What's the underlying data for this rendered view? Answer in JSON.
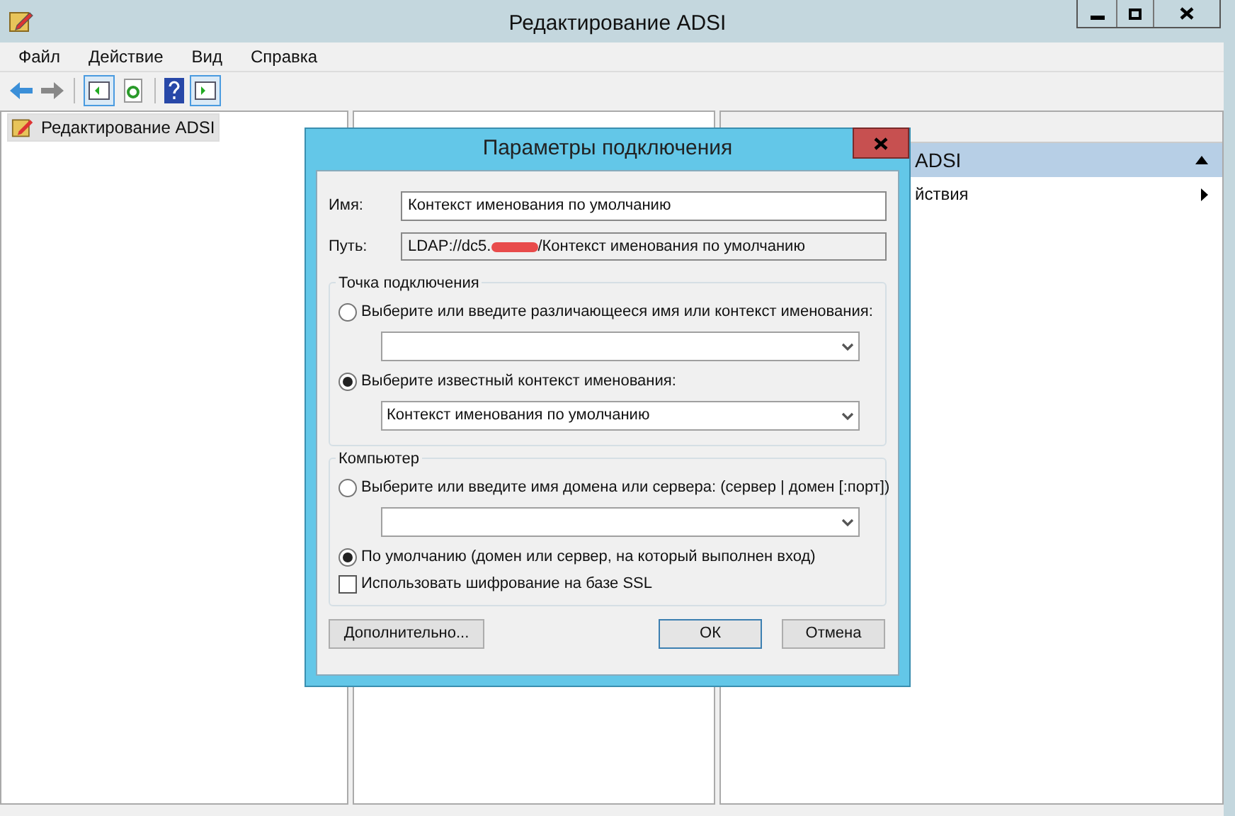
{
  "window": {
    "title": "Редактирование ADSI"
  },
  "menu": [
    "Файл",
    "Действие",
    "Вид",
    "Справка"
  ],
  "tree": {
    "items": [
      {
        "label": "Редактирование ADSI",
        "selected": true
      }
    ]
  },
  "actions_pane": {
    "section": "ADSI",
    "item": "йствия"
  },
  "dialog": {
    "title": "Параметры подключения",
    "name": {
      "label": "Имя:",
      "value": "Контекст именования по умолчанию"
    },
    "path": {
      "label": "Путь:",
      "prefix": "LDAP://dc5.",
      "suffix": "/Контекст именования по умолчанию",
      "redacted": true
    },
    "groups": [
      {
        "title": "Точка подключения",
        "options": [
          {
            "kind": "radio",
            "label": "Выберите или введите различающееся имя или контекст именования:",
            "selected": false
          },
          {
            "kind": "combo"
          },
          {
            "kind": "radio",
            "label": "Выберите известный контекст именования:",
            "selected": true
          },
          {
            "kind": "combo",
            "value": "Контекст именования по умолчанию"
          }
        ]
      },
      {
        "title": "Компьютер",
        "options": [
          {
            "kind": "radio",
            "label": "Выберите или введите имя домена или сервера: (сервер | домен [:порт])",
            "selected": false
          },
          {
            "kind": "combo"
          },
          {
            "kind": "radio",
            "label": "По умолчанию (домен или сервер, на который выполнен вход)",
            "selected": true
          },
          {
            "kind": "checkbox",
            "label": "Использовать шифрование на базе SSL",
            "checked": false
          }
        ]
      }
    ],
    "buttons": [
      {
        "label": "Дополнительно...",
        "default": false
      },
      {
        "label": "ОК",
        "default": true
      },
      {
        "label": "Отмена",
        "default": false
      }
    ]
  }
}
